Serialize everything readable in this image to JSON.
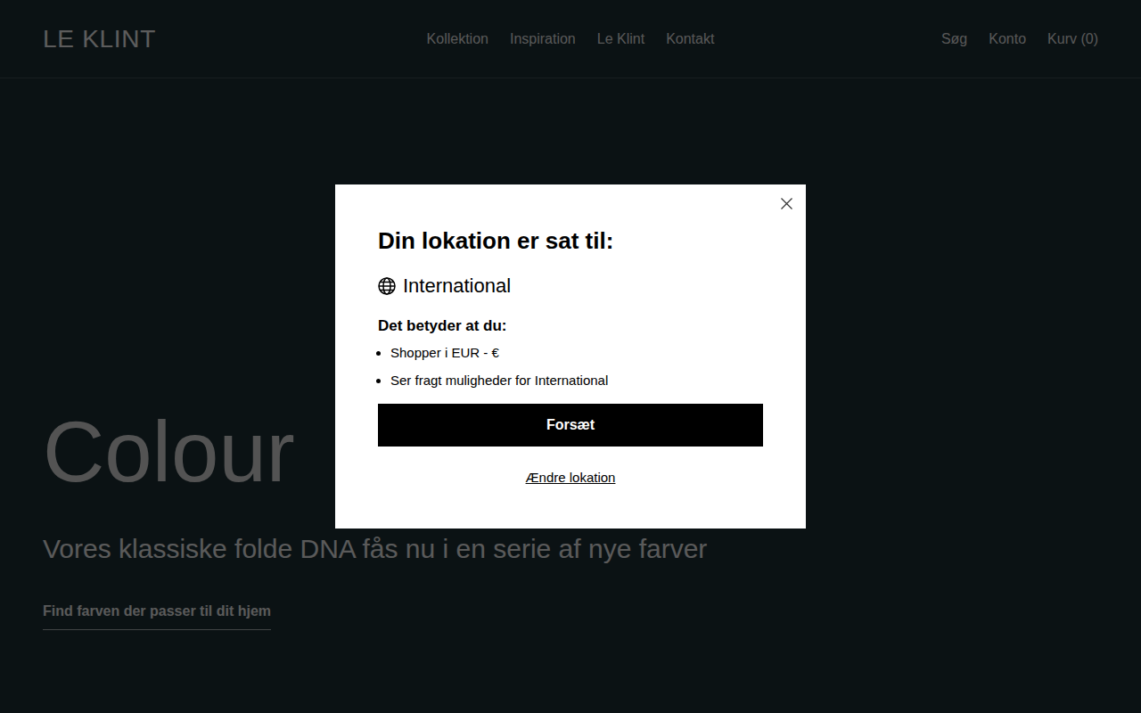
{
  "header": {
    "logo": "LE KLINT",
    "nav": [
      "Kollektion",
      "Inspiration",
      "Le Klint",
      "Kontakt"
    ],
    "actions": [
      "Søg",
      "Konto",
      "Kurv (0)"
    ]
  },
  "hero": {
    "title": "Colour",
    "subtitle": "Vores klassiske folde DNA fås nu i en serie af nye farver",
    "link": "Find farven der passer til dit hjem"
  },
  "modal": {
    "title": "Din lokation er sat til:",
    "location": "International",
    "intro": "Det betyder at du:",
    "points": [
      "Shopper i EUR - €",
      "Ser fragt muligheder for International"
    ],
    "primary": "Forsæt",
    "secondary": "Ændre lokation"
  }
}
